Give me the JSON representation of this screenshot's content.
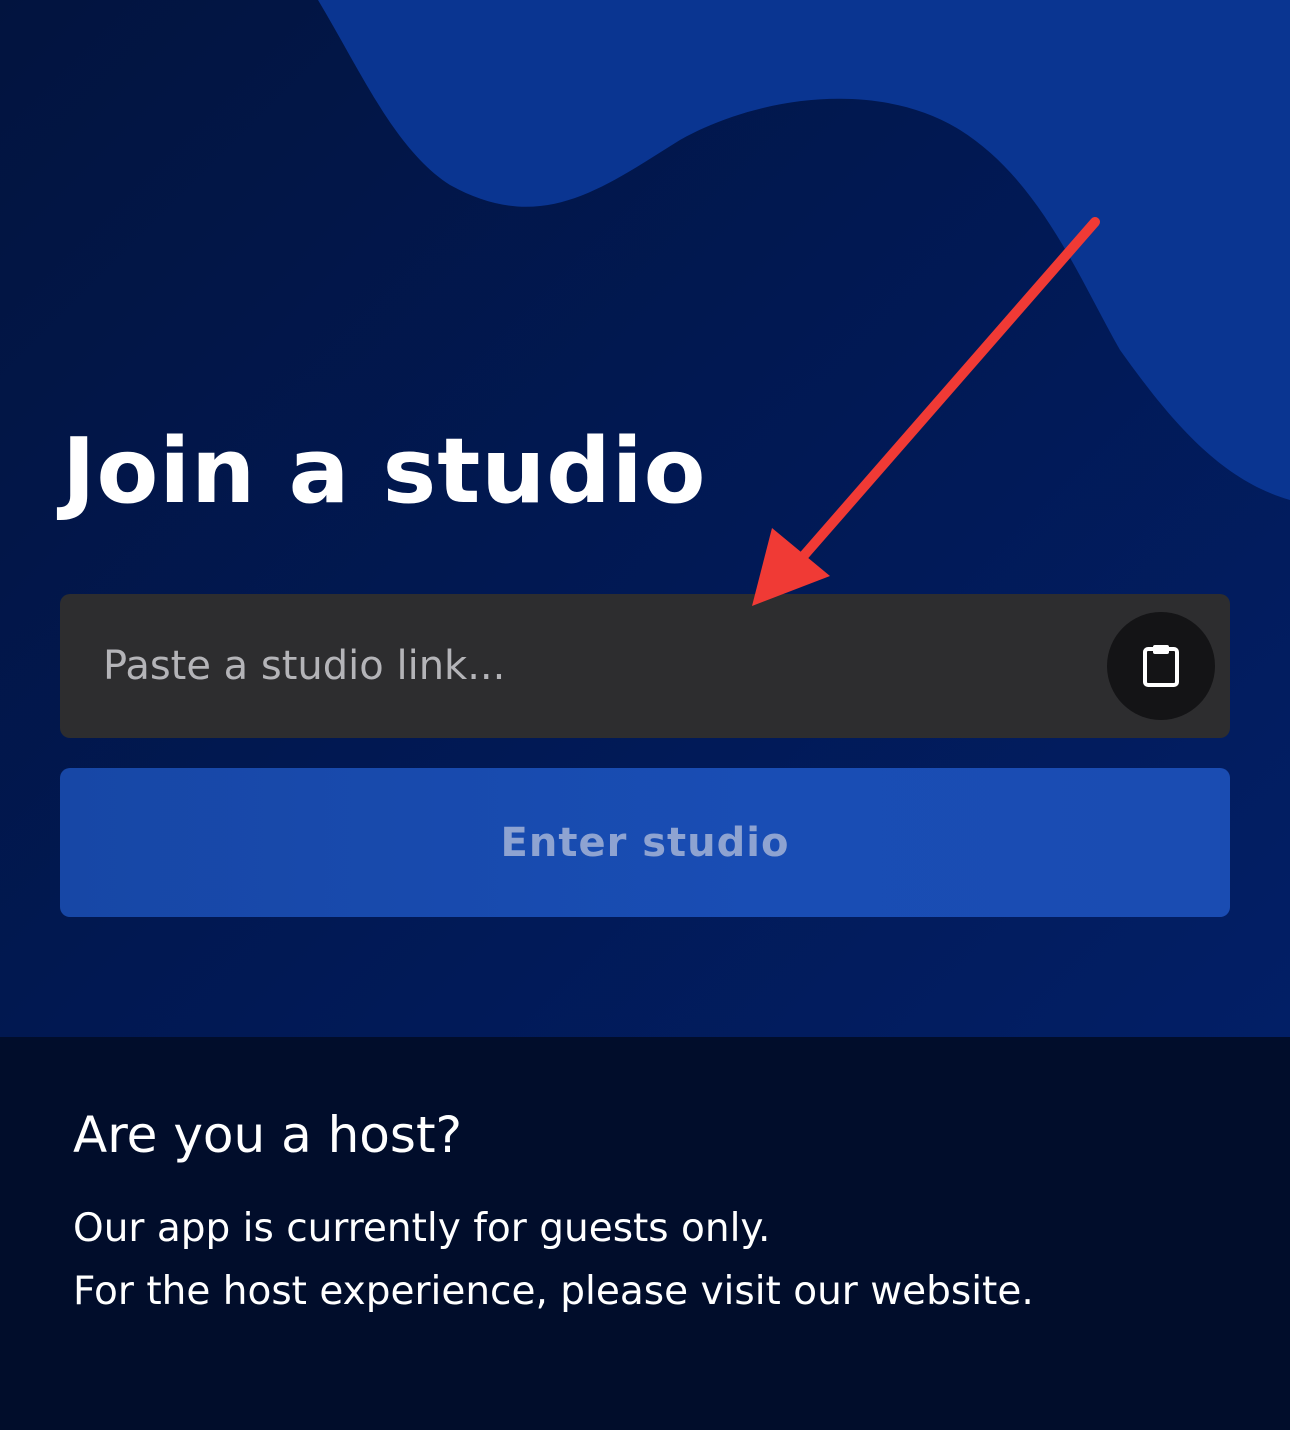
{
  "join": {
    "title": "Join a studio",
    "input_placeholder": "Paste a studio link...",
    "input_value": "",
    "paste_icon": "clipboard-icon",
    "enter_label": "Enter studio"
  },
  "host": {
    "title": "Are you a host?",
    "line_1": "Our app is currently for guests only.",
    "line_2": "For the host experience, please visit our website."
  },
  "colors": {
    "background_top": "#011955",
    "wave": "#0a3591",
    "background_bottom": "#010d2b",
    "input_bg": "#2d2d2f",
    "enter_button": "#194db4",
    "annotation_arrow": "#f03a35"
  }
}
